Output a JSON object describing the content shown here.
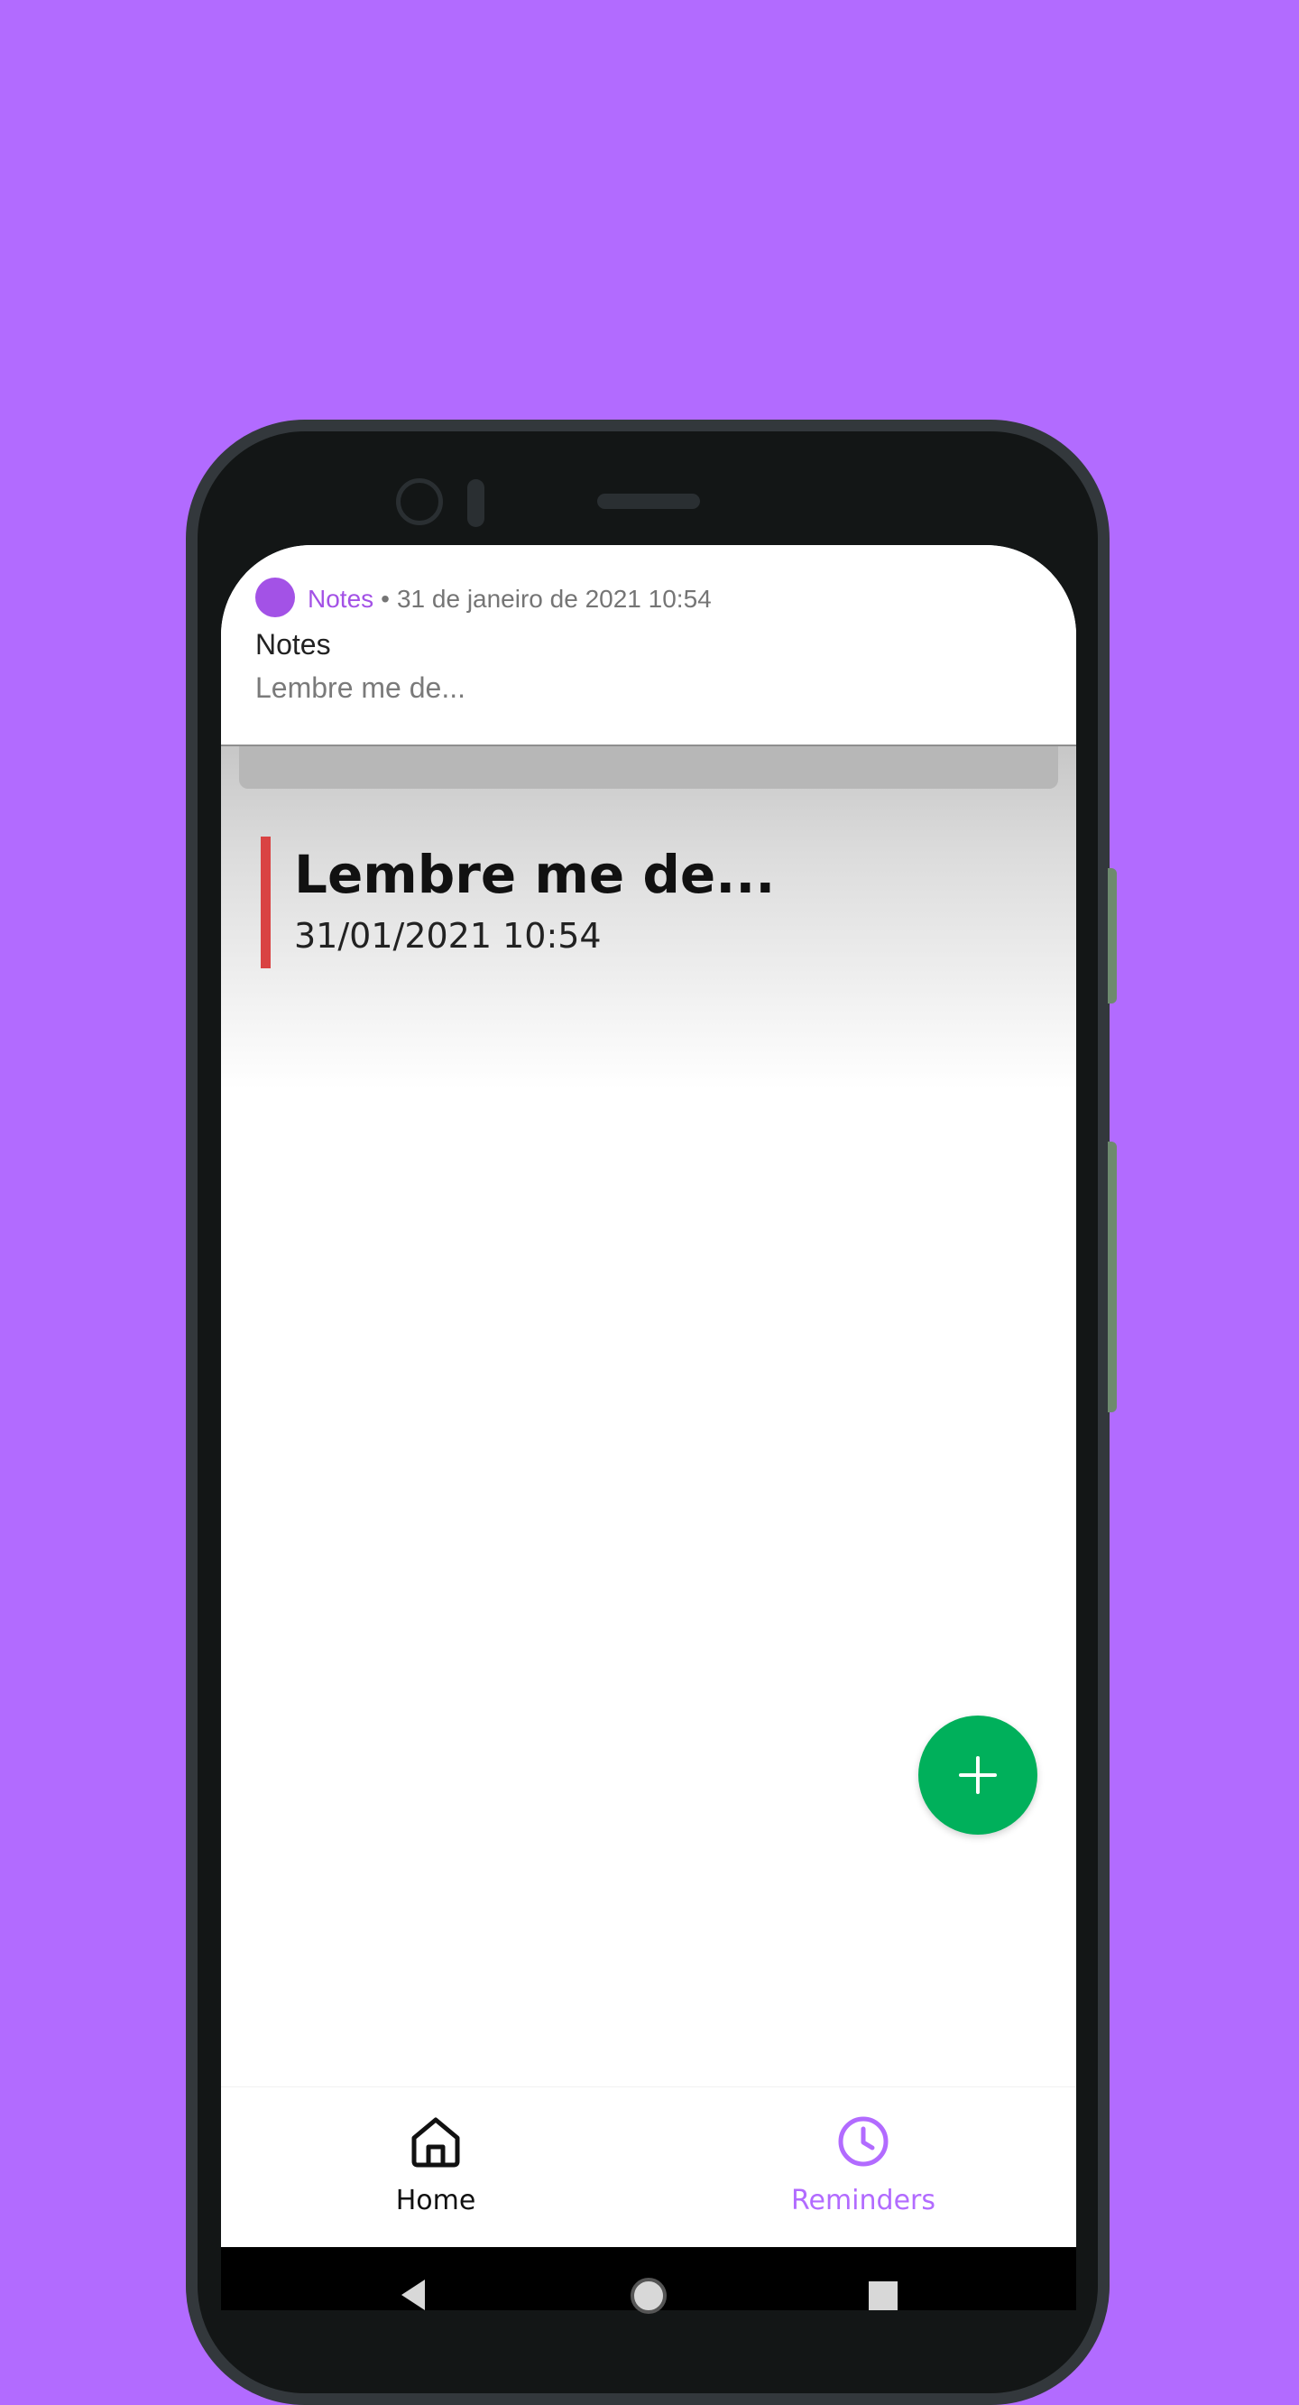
{
  "notification": {
    "app_name": "Notes",
    "separator": "•",
    "timestamp": "31 de janeiro de 2021 10:54",
    "title": "Notes",
    "text": "Lembre me de..."
  },
  "note": {
    "title": "Lembre me de...",
    "date": "31/01/2021 10:54",
    "accent_color": "#d94343"
  },
  "fab": {
    "icon": "plus-icon",
    "color": "#00b05b"
  },
  "bottom_nav": {
    "items": [
      {
        "label": "Home",
        "icon": "home-icon",
        "active": false
      },
      {
        "label": "Reminders",
        "icon": "clock-icon",
        "active": true
      }
    ]
  },
  "system_nav": {
    "icons": [
      "back-icon",
      "home-circle-icon",
      "recents-icon"
    ]
  },
  "colors": {
    "background": "#b26bff",
    "accent_purple": "#a352e6",
    "fab_green": "#00b05b"
  }
}
